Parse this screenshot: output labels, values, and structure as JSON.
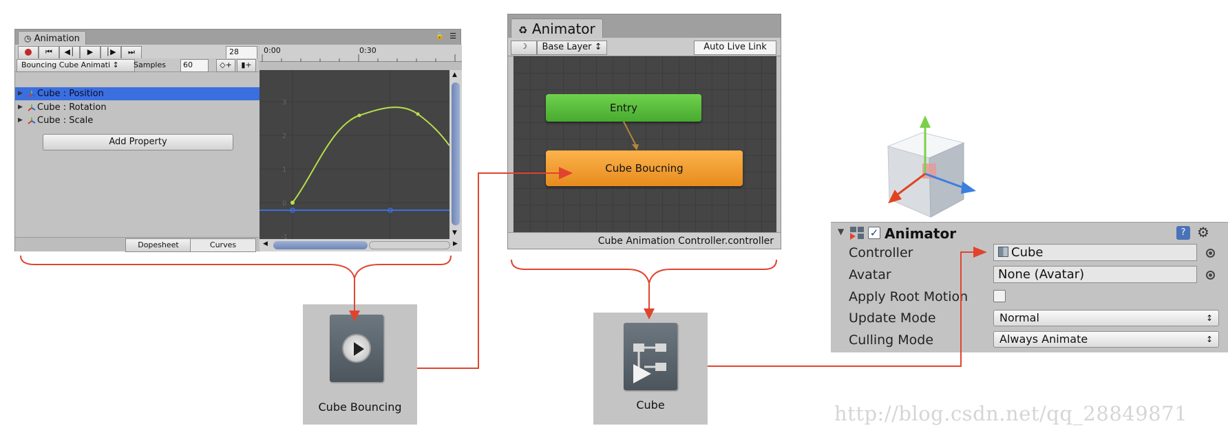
{
  "animation_window": {
    "tab_title": "Animation",
    "frame_value": "28",
    "clip_select": "Bouncing Cube Animati ↕",
    "samples_label": "Samples",
    "samples_value": "60",
    "timeline_ticks": [
      "0:00",
      "0:30"
    ],
    "properties": [
      {
        "label": "Cube : Position",
        "selected": true
      },
      {
        "label": "Cube : Rotation",
        "selected": false
      },
      {
        "label": "Cube : Scale",
        "selected": false
      }
    ],
    "add_property_label": "Add Property",
    "tab_dopesheet": "Dopesheet",
    "tab_curves": "Curves",
    "curve_y_labels": [
      "3",
      "2",
      "1",
      "0",
      "-1"
    ]
  },
  "animator_window": {
    "tab_title": "Animator",
    "layer_select": "Base Layer ↕",
    "auto_live_link": "Auto Live Link",
    "entry_state": "Entry",
    "main_state": "Cube Boucning",
    "footer": "Cube Animation Controller.controller"
  },
  "tiles": {
    "clip_label": "Cube Bouncing",
    "controller_label": "Cube"
  },
  "inspector": {
    "component_title": "Animator",
    "controller_label": "Controller",
    "controller_value": "Cube",
    "avatar_label": "Avatar",
    "avatar_value": "None (Avatar)",
    "apply_root_motion_label": "Apply Root Motion",
    "apply_root_motion": false,
    "update_mode_label": "Update Mode",
    "update_mode_value": "Normal",
    "culling_mode_label": "Culling Mode",
    "culling_mode_value": "Always Animate"
  },
  "watermark": "http://blog.csdn.net/qq_28849871",
  "colors": {
    "selected_row": "#3b6fe0",
    "entry_state": "#5cc140",
    "main_state": "#f0962a",
    "arrow": "#e0442e",
    "curve": "#b8e04a",
    "blue_curve": "#3b6fe0"
  }
}
